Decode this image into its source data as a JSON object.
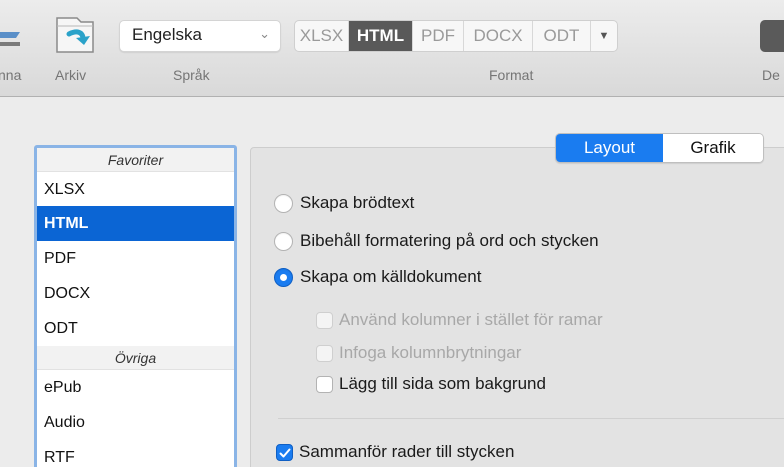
{
  "toolbar": {
    "labels": {
      "partial_left": "nna",
      "arkiv": "Arkiv",
      "sprak": "Språk",
      "format": "Format",
      "partial_right": "De"
    },
    "language_select": {
      "value": "Engelska"
    },
    "format_segments": [
      "XLSX",
      "HTML",
      "PDF",
      "DOCX",
      "ODT"
    ],
    "format_selected": "HTML"
  },
  "sidebar": {
    "group1_header": "Favoriter",
    "group1_items": [
      "XLSX",
      "HTML",
      "PDF",
      "DOCX",
      "ODT"
    ],
    "group2_header": "Övriga",
    "group2_items": [
      "ePub",
      "Audio",
      "RTF"
    ]
  },
  "panel": {
    "tabs": [
      "Layout",
      "Grafik"
    ],
    "active_tab": "Layout",
    "radios": [
      "Skapa brödtext",
      "Bibehåll formatering på ord och stycken",
      "Skapa om källdokument"
    ],
    "sub_checks": [
      "Använd kolumner i stället för ramar",
      "Infoga kolumnbrytningar",
      "Lägg till sida som bakgrund"
    ],
    "merge_check": "Sammanför rader till stycken"
  },
  "colors": {
    "accent": "#1a7cf0",
    "selection": "#0b65d4",
    "segment_active": "#595959"
  }
}
